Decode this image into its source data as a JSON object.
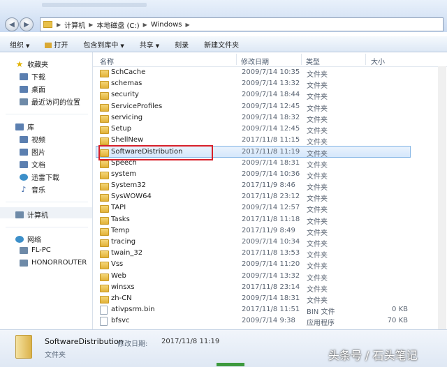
{
  "address": {
    "crumbs": [
      "计算机",
      "本地磁盘 (C:)",
      "Windows"
    ]
  },
  "toolbar": {
    "organize": "组织",
    "open": "打开",
    "include_in_library": "包含到库中",
    "share": "共享",
    "burn": "刻录",
    "new_folder": "新建文件夹"
  },
  "sidebar": {
    "favorites": "收藏夹",
    "downloads": "下载",
    "desktop": "桌面",
    "recent": "最近访问的位置",
    "libraries": "库",
    "videos": "视频",
    "pictures": "图片",
    "documents": "文档",
    "thunder": "迅雷下载",
    "music": "音乐",
    "computer": "计算机",
    "network": "网络",
    "fl_pc": "FL-PC",
    "router": "HONORROUTER"
  },
  "columns": {
    "name": "名称",
    "modified": "修改日期",
    "type": "类型",
    "size": "大小"
  },
  "files": [
    {
      "name": "SchCache",
      "date": "2009/7/14 10:35",
      "type": "文件夹",
      "size": "",
      "kind": "folder"
    },
    {
      "name": "schemas",
      "date": "2009/7/14 13:32",
      "type": "文件夹",
      "size": "",
      "kind": "folder"
    },
    {
      "name": "security",
      "date": "2009/7/14 18:44",
      "type": "文件夹",
      "size": "",
      "kind": "folder"
    },
    {
      "name": "ServiceProfiles",
      "date": "2009/7/14 12:45",
      "type": "文件夹",
      "size": "",
      "kind": "folder"
    },
    {
      "name": "servicing",
      "date": "2009/7/14 18:32",
      "type": "文件夹",
      "size": "",
      "kind": "folder"
    },
    {
      "name": "Setup",
      "date": "2009/7/14 12:45",
      "type": "文件夹",
      "size": "",
      "kind": "folder"
    },
    {
      "name": "ShellNew",
      "date": "2017/11/8 11:15",
      "type": "文件夹",
      "size": "",
      "kind": "folder"
    },
    {
      "name": "SoftwareDistribution",
      "date": "2017/11/8 11:19",
      "type": "文件夹",
      "size": "",
      "kind": "folder"
    },
    {
      "name": "Speech",
      "date": "2009/7/14 18:31",
      "type": "文件夹",
      "size": "",
      "kind": "folder"
    },
    {
      "name": "system",
      "date": "2009/7/14 10:36",
      "type": "文件夹",
      "size": "",
      "kind": "folder"
    },
    {
      "name": "System32",
      "date": "2017/11/9 8:46",
      "type": "文件夹",
      "size": "",
      "kind": "folder"
    },
    {
      "name": "SysWOW64",
      "date": "2017/11/8 23:12",
      "type": "文件夹",
      "size": "",
      "kind": "folder"
    },
    {
      "name": "TAPI",
      "date": "2009/7/14 12:57",
      "type": "文件夹",
      "size": "",
      "kind": "folder"
    },
    {
      "name": "Tasks",
      "date": "2017/11/8 11:18",
      "type": "文件夹",
      "size": "",
      "kind": "folder"
    },
    {
      "name": "Temp",
      "date": "2017/11/9 8:49",
      "type": "文件夹",
      "size": "",
      "kind": "folder"
    },
    {
      "name": "tracing",
      "date": "2009/7/14 10:34",
      "type": "文件夹",
      "size": "",
      "kind": "folder"
    },
    {
      "name": "twain_32",
      "date": "2017/11/8 13:53",
      "type": "文件夹",
      "size": "",
      "kind": "folder"
    },
    {
      "name": "Vss",
      "date": "2009/7/14 11:20",
      "type": "文件夹",
      "size": "",
      "kind": "folder"
    },
    {
      "name": "Web",
      "date": "2009/7/14 13:32",
      "type": "文件夹",
      "size": "",
      "kind": "folder"
    },
    {
      "name": "winsxs",
      "date": "2017/11/8 23:14",
      "type": "文件夹",
      "size": "",
      "kind": "folder"
    },
    {
      "name": "zh-CN",
      "date": "2009/7/14 18:31",
      "type": "文件夹",
      "size": "",
      "kind": "folder"
    },
    {
      "name": "ativpsrm.bin",
      "date": "2017/11/8 11:51",
      "type": "BIN 文件",
      "size": "0 KB",
      "kind": "file"
    },
    {
      "name": "bfsvc",
      "date": "2009/7/14 9:38",
      "type": "应用程序",
      "size": "70 KB",
      "kind": "file"
    }
  ],
  "details": {
    "name": "SoftwareDistribution",
    "modified_label": "修改日期:",
    "modified": "2017/11/8 11:19",
    "type": "文件夹"
  },
  "watermark": "头条号 / 石头笔记"
}
